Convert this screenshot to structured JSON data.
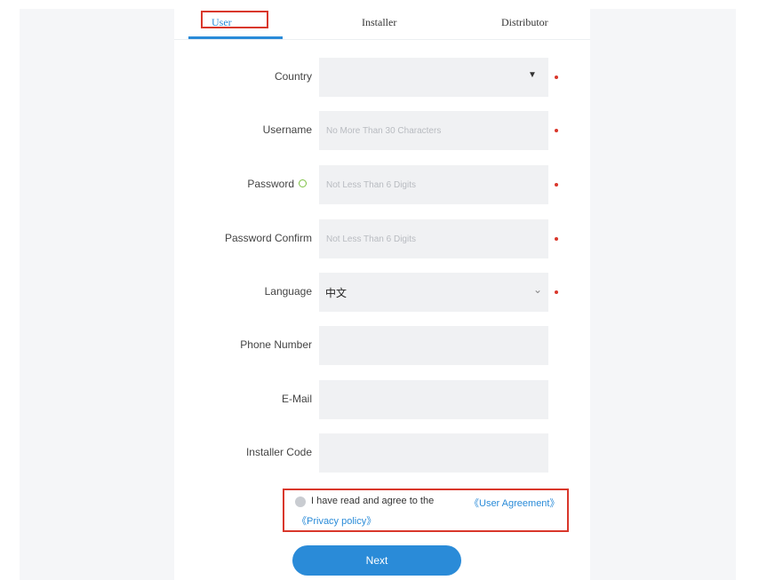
{
  "tabs": {
    "user": "User",
    "installer": "Installer",
    "distributor": "Distributor"
  },
  "form": {
    "country": {
      "label": "Country",
      "value": "",
      "caret": "▼"
    },
    "username": {
      "label": "Username",
      "placeholder": "No More Than 30 Characters"
    },
    "password": {
      "label": "Password",
      "placeholder": "Not Less Than 6 Digits"
    },
    "password_confirm": {
      "label": "Password Confirm",
      "placeholder": "Not Less Than 6 Digits"
    },
    "language": {
      "label": "Language",
      "value": "中文",
      "chevron": "⌄"
    },
    "phone": {
      "label": "Phone Number",
      "placeholder": ""
    },
    "email": {
      "label": "E-Mail",
      "placeholder": ""
    },
    "installer_code": {
      "label": "Installer Code",
      "placeholder": ""
    }
  },
  "agreement": {
    "text": "I have read and agree to the",
    "user_agreement": "《User Agreement》",
    "privacy_policy": "《Privacy policy》"
  },
  "next_button": "Next",
  "colors": {
    "accent": "#2a8bd8",
    "required": "#d9372b",
    "highlight_border": "#d9372b"
  }
}
